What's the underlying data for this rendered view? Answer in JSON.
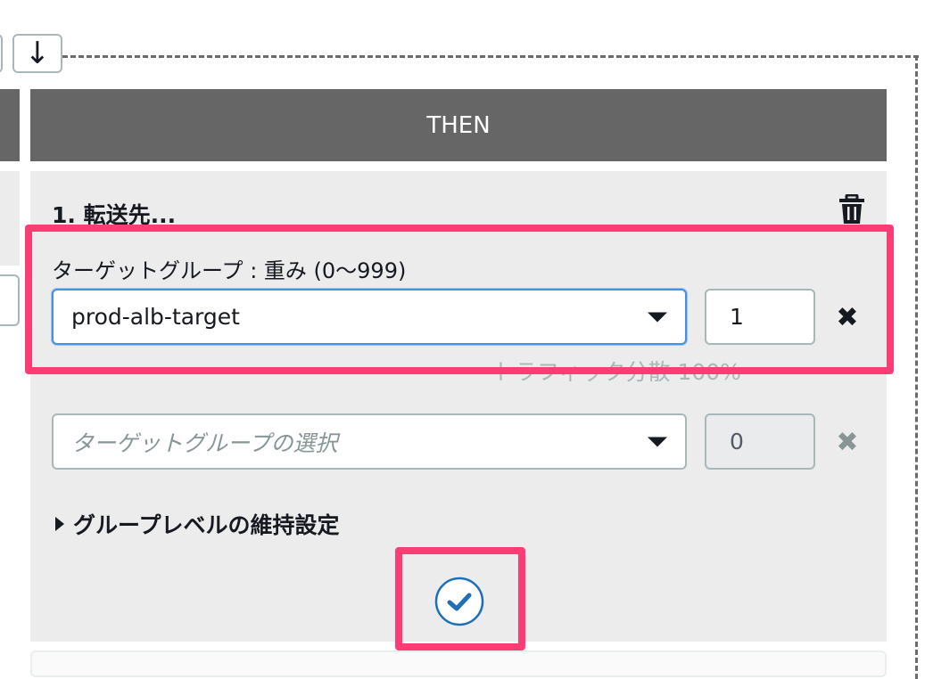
{
  "move_down_icon": "arrow-down-icon",
  "then_header": "THEN",
  "action": {
    "title": "1. 転送先...",
    "delete_icon": "trash-icon",
    "field_label": "ターゲットグループ : 重み (0〜999)",
    "targets": [
      {
        "value": "prod-alb-target",
        "placeholder": "",
        "weight": "1"
      },
      {
        "value": "",
        "placeholder": "ターゲットグループの選択",
        "weight": "0"
      }
    ],
    "traffic_text": "トラフィック分散 100%",
    "stickiness_label": "グループレベルの維持設定",
    "confirm_icon": "check-circle-icon"
  },
  "colors": {
    "header_bg": "#666666",
    "panel_bg": "#ececec",
    "highlight": "#fb3c75",
    "confirm_blue": "#1f6fb8"
  }
}
